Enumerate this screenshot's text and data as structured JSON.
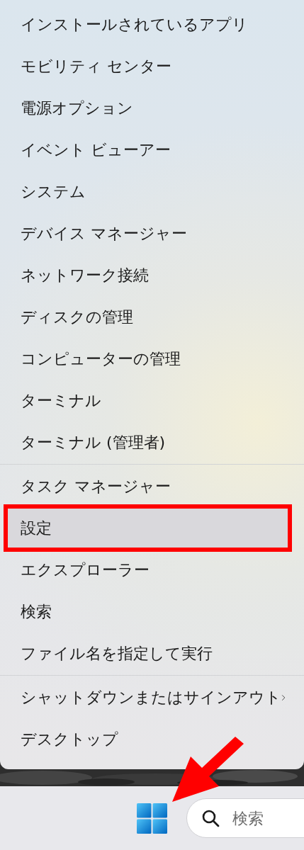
{
  "menu": {
    "groups": [
      {
        "items": [
          {
            "label": "インストールされているアプリ",
            "selected": false,
            "boxed": false,
            "submenu": false
          },
          {
            "label": "モビリティ センター",
            "selected": false,
            "boxed": false,
            "submenu": false
          },
          {
            "label": "電源オプション",
            "selected": false,
            "boxed": false,
            "submenu": false
          },
          {
            "label": "イベント ビューアー",
            "selected": false,
            "boxed": false,
            "submenu": false
          },
          {
            "label": "システム",
            "selected": false,
            "boxed": false,
            "submenu": false
          },
          {
            "label": "デバイス マネージャー",
            "selected": false,
            "boxed": false,
            "submenu": false
          },
          {
            "label": "ネットワーク接続",
            "selected": false,
            "boxed": false,
            "submenu": false
          },
          {
            "label": "ディスクの管理",
            "selected": false,
            "boxed": false,
            "submenu": false
          },
          {
            "label": "コンピューターの管理",
            "selected": false,
            "boxed": false,
            "submenu": false
          },
          {
            "label": "ターミナル",
            "selected": false,
            "boxed": false,
            "submenu": false
          },
          {
            "label": "ターミナル (管理者)",
            "selected": false,
            "boxed": false,
            "submenu": false
          }
        ]
      },
      {
        "items": [
          {
            "label": "タスク マネージャー",
            "selected": false,
            "boxed": false,
            "submenu": false
          },
          {
            "label": "設定",
            "selected": true,
            "boxed": true,
            "submenu": false
          },
          {
            "label": "エクスプローラー",
            "selected": false,
            "boxed": false,
            "submenu": false
          },
          {
            "label": "検索",
            "selected": false,
            "boxed": false,
            "submenu": false
          },
          {
            "label": "ファイル名を指定して実行",
            "selected": false,
            "boxed": false,
            "submenu": false
          }
        ]
      },
      {
        "items": [
          {
            "label": "シャットダウンまたはサインアウト",
            "selected": false,
            "boxed": false,
            "submenu": true
          },
          {
            "label": "デスクトップ",
            "selected": false,
            "boxed": false,
            "submenu": false
          }
        ]
      }
    ]
  },
  "taskbar": {
    "search": {
      "placeholder": "検索"
    }
  },
  "annotations": [
    {
      "kind": "arrow"
    }
  ]
}
